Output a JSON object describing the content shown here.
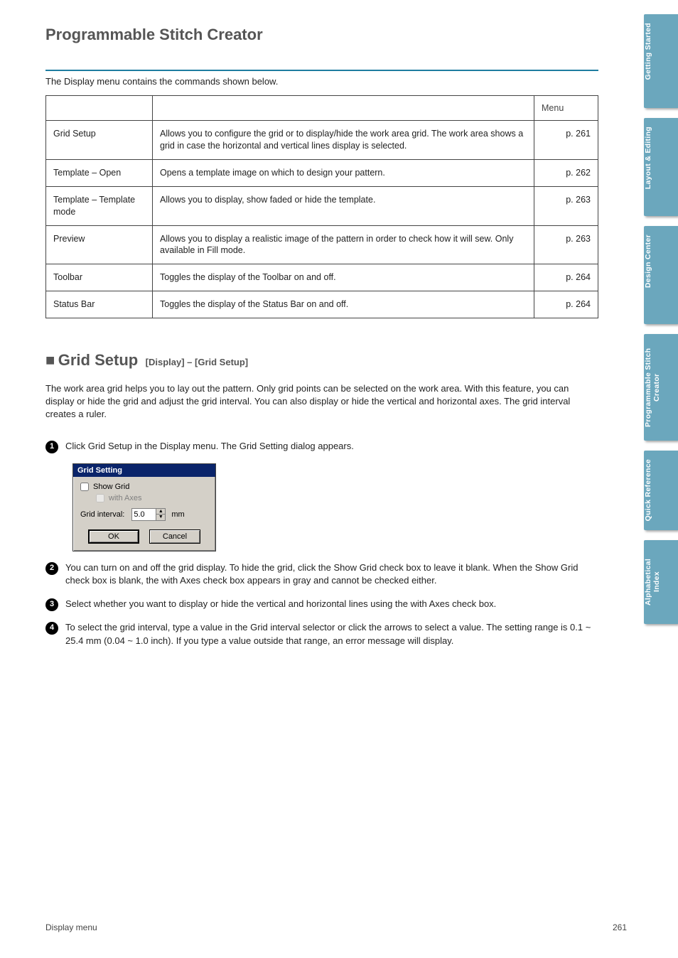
{
  "page_title": "Programmable Stitch Creator",
  "intro_text": "The Display menu contains the commands shown below.",
  "table": {
    "headers": [
      "",
      "",
      "Menu"
    ],
    "rows": [
      {
        "c1": "Grid Setup",
        "c2": "Allows you to configure the grid or to display/hide the work area grid. The work area shows a grid in case the horizontal and vertical lines display is selected.",
        "c3": "p. 261"
      },
      {
        "c1": "Template – Open",
        "c2": "Opens a template image on which to design your pattern.",
        "c3": "p. 262"
      },
      {
        "c1": "Template – Template mode",
        "c2": "Allows you to display, show faded or hide the template.",
        "c3": "p. 263"
      },
      {
        "c1": "Preview",
        "c2": "Allows you to display a realistic image of the pattern in order to check how it will sew. Only available in Fill mode.",
        "c3": "p. 263"
      },
      {
        "c1": "Toolbar",
        "c2": "Toggles the display of the Toolbar on and off.",
        "c3": "p. 264"
      },
      {
        "c1": "Status Bar",
        "c2": "Toggles the display of the Status Bar on and off.",
        "c3": "p. 264"
      }
    ]
  },
  "section": {
    "anchor": "■",
    "label": "Grid Setup",
    "shortcut": "[Display] – [Grid Setup]",
    "desc": "The work area grid helps you to lay out the pattern. Only grid points can be selected on the work area.\nWith this feature, you can display or hide the grid and adjust the grid interval. You can also display or hide the vertical and horizontal axes. The grid interval creates a ruler."
  },
  "dialog": {
    "title": "Grid Setting",
    "show_grid": "Show Grid",
    "with_axes": "with Axes",
    "interval_label": "Grid interval:",
    "interval_value": "5.0",
    "unit": "mm",
    "ok": "OK",
    "cancel": "Cancel"
  },
  "steps": [
    "Click Grid Setup in the Display menu. The Grid Setting dialog appears.",
    "You can turn on and off the grid display. To hide the grid, click the Show Grid check box to leave it blank. When the Show Grid check box is blank, the with Axes check box appears in gray and cannot be checked either.",
    "Select whether you want to display or hide the vertical and horizontal lines using the with Axes check box.",
    "To select the grid interval, type a value in the Grid interval selector or click the arrows to select a value. The setting range is 0.1 ~ 25.4 mm (0.04 ~ 1.0 inch). If you type a value outside that range, an error message will display."
  ],
  "tabs": [
    "Getting Started",
    "Layout & Editing",
    "Design Center",
    "Programmable Stitch Creator",
    "Quick Reference",
    "Alphabetical Index"
  ],
  "tab_heights": [
    132,
    138,
    138,
    150,
    112,
    118
  ],
  "footer": {
    "left": "Display menu",
    "right": "261"
  }
}
